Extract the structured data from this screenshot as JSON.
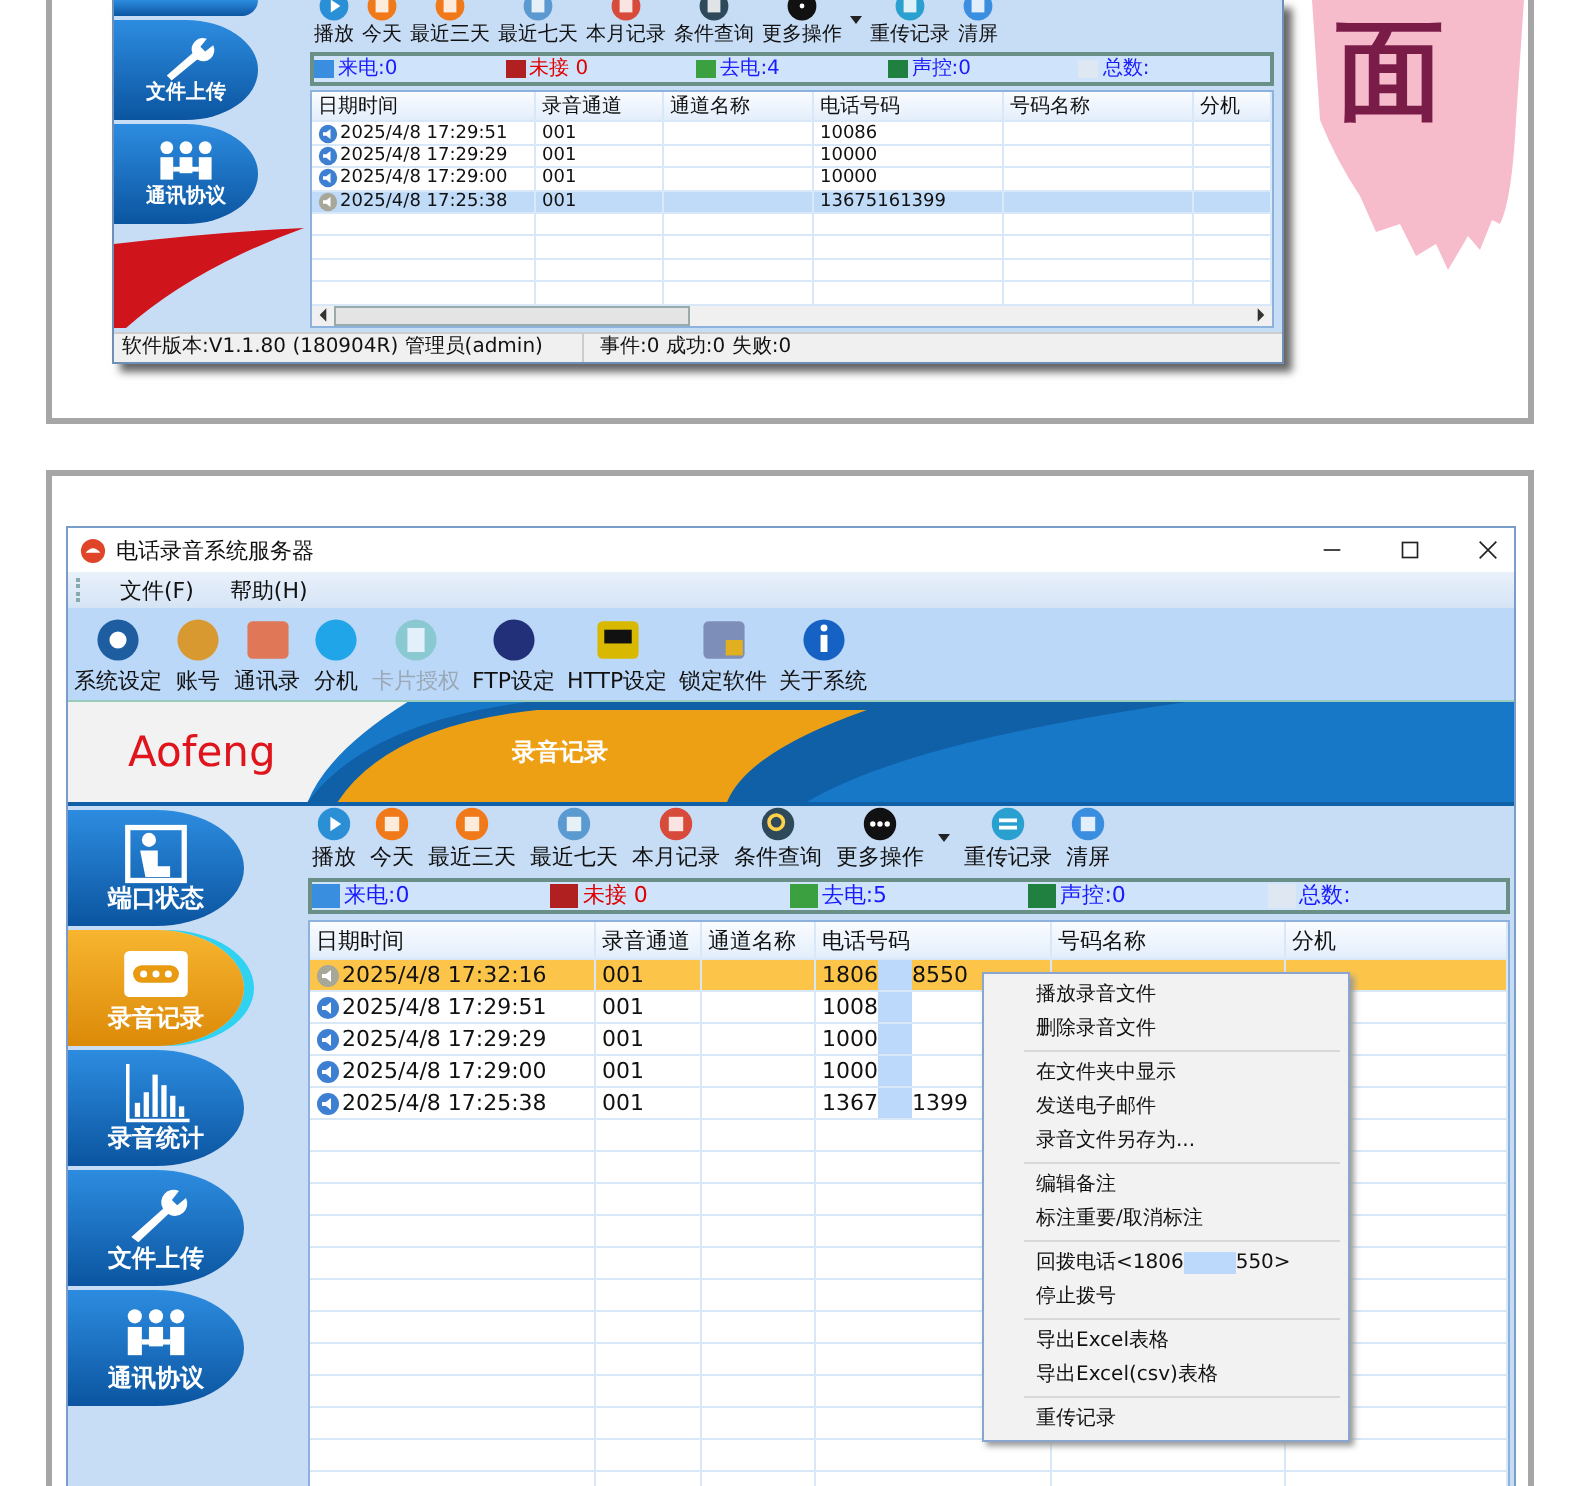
{
  "top_window": {
    "sidebar": [
      {
        "label": "文件上传",
        "kind": "wrench",
        "selected": false
      },
      {
        "label": "通讯协议",
        "kind": "people",
        "selected": false
      }
    ],
    "toolbar": [
      "播放",
      "今天",
      "最近三天",
      "最近七天",
      "本月记录",
      "条件查询",
      "更多操作",
      "重传记录",
      "清屏"
    ],
    "stats": [
      {
        "label": "来电:0",
        "color": "#1a1aff"
      },
      {
        "label": "未接 0",
        "color": "#e00000"
      },
      {
        "label": "去电:4",
        "color": "#1a1aff"
      },
      {
        "label": "声控:0",
        "color": "#1a1aff"
      },
      {
        "label": "总数:",
        "color": "#1a1aff"
      }
    ],
    "columns": [
      "日期时间",
      "录音通道",
      "通道名称",
      "电话号码",
      "号码名称",
      "分机"
    ],
    "rows": [
      {
        "time": "2025/4/8 17:29:51",
        "channel": "001",
        "phone": "10086",
        "selected": false
      },
      {
        "time": "2025/4/8 17:29:29",
        "channel": "001",
        "phone": "10000",
        "selected": false
      },
      {
        "time": "2025/4/8 17:29:00",
        "channel": "001",
        "phone": "10000",
        "selected": false
      },
      {
        "time": "2025/4/8 17:25:38",
        "channel": "001",
        "phone": "13675161399",
        "selected": true
      }
    ],
    "status_bar": [
      "软件版本:V1.1.80 (180904R) 管理员(admin)",
      "事件:0 成功:0 失败:0"
    ]
  },
  "heading_char": "面",
  "bottom_window": {
    "title": "电话录音系统服务器",
    "menu": [
      "文件(F)",
      "帮助(H)"
    ],
    "app_toolbar": [
      {
        "label": "系统设定",
        "disabled": false
      },
      {
        "label": "账号",
        "disabled": false
      },
      {
        "label": "通讯录",
        "disabled": false
      },
      {
        "label": "分机",
        "disabled": false
      },
      {
        "label": "卡片授权",
        "disabled": true
      },
      {
        "label": "FTP设定",
        "disabled": false
      },
      {
        "label": "HTTP设定",
        "disabled": false
      },
      {
        "label": "锁定软件",
        "disabled": false
      },
      {
        "label": "关于系统",
        "disabled": false
      }
    ],
    "logo": "Aofeng",
    "banner_title": "录音记录",
    "sidebar": [
      {
        "label": "端口状态",
        "kind": "port",
        "selected": false
      },
      {
        "label": "录音记录",
        "kind": "cassette",
        "selected": true
      },
      {
        "label": "录音统计",
        "kind": "chart",
        "selected": false
      },
      {
        "label": "文件上传",
        "kind": "wrench",
        "selected": false
      },
      {
        "label": "通讯协议",
        "kind": "people",
        "selected": false
      }
    ],
    "toolbar": [
      "播放",
      "今天",
      "最近三天",
      "最近七天",
      "本月记录",
      "条件查询",
      "更多操作",
      "重传记录",
      "清屏"
    ],
    "stats": [
      {
        "label": "来电:0",
        "color": "#1a1aff"
      },
      {
        "label": "未接 0",
        "color": "#e00000"
      },
      {
        "label": "去电:5",
        "color": "#1a1aff"
      },
      {
        "label": "声控:0",
        "color": "#1a1aff"
      },
      {
        "label": "总数:",
        "color": "#1a1aff"
      }
    ],
    "columns": [
      "日期时间",
      "录音通道",
      "通道名称",
      "电话号码",
      "号码名称",
      "分机"
    ],
    "rows": [
      {
        "time": "2025/4/8 17:32:16",
        "channel": "001",
        "phone": "1806",
        "phone_tail": "8550",
        "masked": true,
        "selected": true
      },
      {
        "time": "2025/4/8 17:29:51",
        "channel": "001",
        "phone": "1008",
        "masked": true,
        "selected": false
      },
      {
        "time": "2025/4/8 17:29:29",
        "channel": "001",
        "phone": "1000",
        "masked": true,
        "selected": false
      },
      {
        "time": "2025/4/8 17:29:00",
        "channel": "001",
        "phone": "1000",
        "masked": true,
        "selected": false
      },
      {
        "time": "2025/4/8 17:25:38",
        "channel": "001",
        "phone": "1367",
        "phone_tail": "1399",
        "masked": true,
        "selected": false
      }
    ],
    "context_menu": [
      [
        {
          "text": "播放录音文件"
        },
        {
          "text": "删除录音文件"
        }
      ],
      [
        {
          "text": "在文件夹中显示"
        },
        {
          "text": "发送电子邮件"
        },
        {
          "text": "录音文件另存为..."
        }
      ],
      [
        {
          "text": "编辑备注"
        },
        {
          "text": "标注重要/取消标注"
        }
      ],
      [
        {
          "text": "回拨电话<1806",
          "tail": "550>",
          "masked": true
        },
        {
          "text": "停止拨号"
        }
      ],
      [
        {
          "text": "导出Excel表格"
        },
        {
          "text": "导出Excel(csv)表格"
        }
      ],
      [
        {
          "text": "重传记录"
        }
      ]
    ]
  }
}
